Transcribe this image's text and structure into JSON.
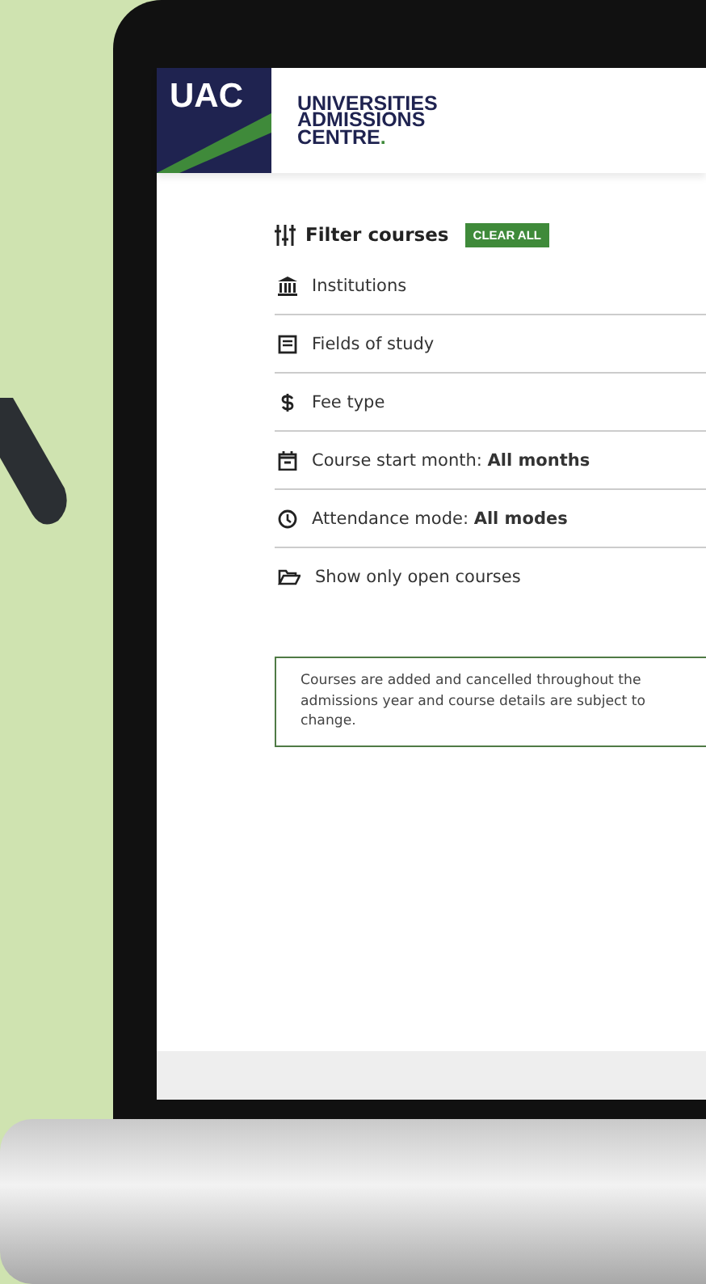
{
  "logo": {
    "mark": "UAC",
    "name_lines": [
      "UNIVERSITIES",
      "ADMISSIONS",
      "CENTRE"
    ],
    "dot": "."
  },
  "filter": {
    "title": "Filter courses",
    "clear_button": "CLEAR ALL",
    "items": [
      {
        "kind": "institution",
        "label": "Institutions"
      },
      {
        "kind": "book",
        "label": "Fields of study"
      },
      {
        "kind": "dollar",
        "label": "Fee type"
      },
      {
        "kind": "calendar",
        "label": "Course start month: **All months**"
      },
      {
        "kind": "clock",
        "label": "Attendance mode: **All modes**"
      },
      {
        "kind": "folder",
        "label": "Show only open courses"
      }
    ]
  },
  "notice": "Courses are added and cancelled throughout the admissions year and course details are subject to change."
}
